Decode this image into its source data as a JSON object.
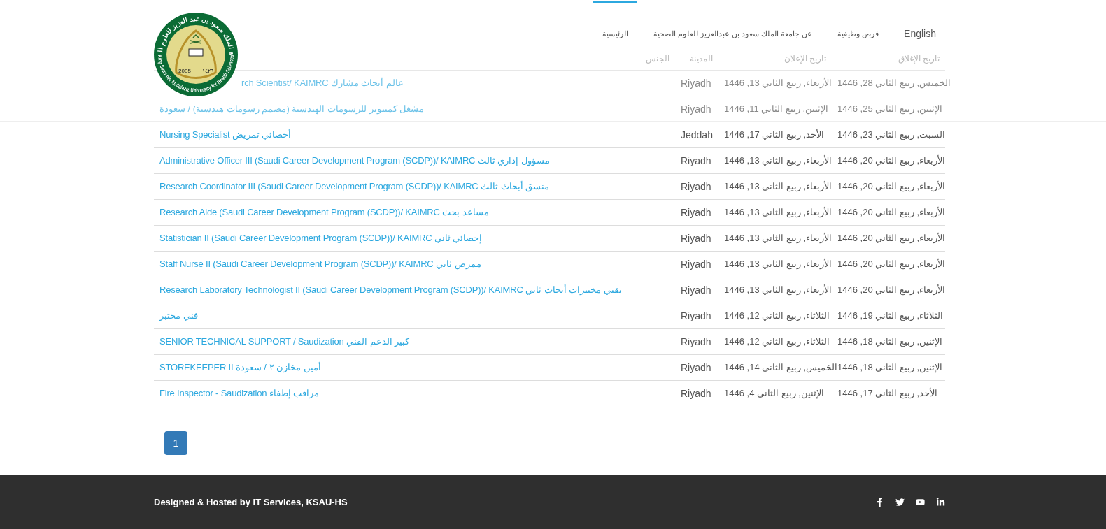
{
  "logo": {
    "arabic_name": "جامعة الملك سعود بن عبد العزيز للعلوم الصحية",
    "english_name": "King Saud bin Abdulaziz University for Health Sciences",
    "year": "2005",
    "hijri_year": "١٤٢٦"
  },
  "nav": [
    {
      "label": "English",
      "selected": false
    },
    {
      "label": "فرص وظيفية",
      "selected": false
    },
    {
      "label": "عن جامعة الملك سعود بن عبدالعزيز للعلوم الصحية",
      "selected": false
    },
    {
      "label": "الرئيسية",
      "selected": true
    }
  ],
  "table": {
    "columns": [
      {
        "label": "تاريخ الإغلاق"
      },
      {
        "label": "تاريخ الإعلان"
      },
      {
        "label": "المدينة"
      },
      {
        "label": "الجنس"
      }
    ],
    "rows": [
      {
        "title": "rch Scientist/ KAIMRC عالم أبحاث مشارك",
        "city": "Riyadh",
        "posted": "الأربعاء, ربيع الثاني 13, 1446",
        "closing": "الخميس, ربيع الثاني 28, 1446"
      },
      {
        "title": "مشغل كمبيوتر للرسومات الهندسية (مصمم رسومات هندسية) / سعودة",
        "city": "Riyadh",
        "posted": "الإثنين, ربيع الثاني 11, 1446",
        "closing": "الإثنين, ربيع الثاني 25, 1446"
      },
      {
        "title": "Nursing Specialist أخصائي تمريض",
        "city": "Jeddah",
        "posted": "الأحد, ربيع الثاني 17, 1446",
        "closing": "السبت, ربيع الثاني 23, 1446"
      },
      {
        "title": "Administrative Officer III (Saudi Career Development Program (SCDP))/ KAIMRC مسؤول إداري ثالث",
        "city": "Riyadh",
        "posted": "الأربعاء, ربيع الثاني 13, 1446",
        "closing": "الأربعاء, ربيع الثاني 20, 1446"
      },
      {
        "title": "Research Coordinator III (Saudi Career Development Program (SCDP))/ KAIMRC منسق أبحاث ثالث",
        "city": "Riyadh",
        "posted": "الأربعاء, ربيع الثاني 13, 1446",
        "closing": "الأربعاء, ربيع الثاني 20, 1446"
      },
      {
        "title": "Research Aide (Saudi Career Development Program (SCDP))/ KAIMRC مساعد بحث",
        "city": "Riyadh",
        "posted": "الأربعاء, ربيع الثاني 13, 1446",
        "closing": "الأربعاء, ربيع الثاني 20, 1446"
      },
      {
        "title": "Statistician II (Saudi Career Development Program (SCDP))/ KAIMRC إحصائي ثاني",
        "city": "Riyadh",
        "posted": "الأربعاء, ربيع الثاني 13, 1446",
        "closing": "الأربعاء, ربيع الثاني 20, 1446"
      },
      {
        "title": "Staff Nurse II (Saudi Career Development Program (SCDP))/ KAIMRC ممرض ثاني",
        "city": "Riyadh",
        "posted": "الأربعاء, ربيع الثاني 13, 1446",
        "closing": "الأربعاء, ربيع الثاني 20, 1446"
      },
      {
        "title": "Research Laboratory Technologist II (Saudi Career Development Program (SCDP))/ KAIMRC تقني مختبرات أبحاث ثاني",
        "city": "Riyadh",
        "posted": "الأربعاء, ربيع الثاني 13, 1446",
        "closing": "الأربعاء, ربيع الثاني 20, 1446"
      },
      {
        "title": "فني مختبر",
        "city": "Riyadh",
        "posted": "الثلاثاء, ربيع الثاني 12, 1446",
        "closing": "الثلاثاء, ربيع الثاني 19, 1446"
      },
      {
        "title": "SENIOR TECHNICAL SUPPORT / Saudization كبير الدعم الفني",
        "city": "Riyadh",
        "posted": "الثلاثاء, ربيع الثاني 12, 1446",
        "closing": "الإثنين, ربيع الثاني 18, 1446"
      },
      {
        "title": "STOREKEEPER II أمين مخازن ٢ / سعودة",
        "city": "Riyadh",
        "posted": "الخميس, ربيع الثاني 14, 1446",
        "closing": "الإثنين, ربيع الثاني 18, 1446"
      },
      {
        "title": "Fire Inspector - Saudization مراقب إطفاء",
        "city": "Riyadh",
        "posted": "الإثنين, ربيع الثاني 4, 1446",
        "closing": "الأحد, ربيع الثاني 17, 1446"
      }
    ]
  },
  "pagination": [
    {
      "label": "1",
      "selected": true
    }
  ],
  "footer": {
    "credit": "Designed & Hosted by IT Services, KSAU-HS"
  }
}
